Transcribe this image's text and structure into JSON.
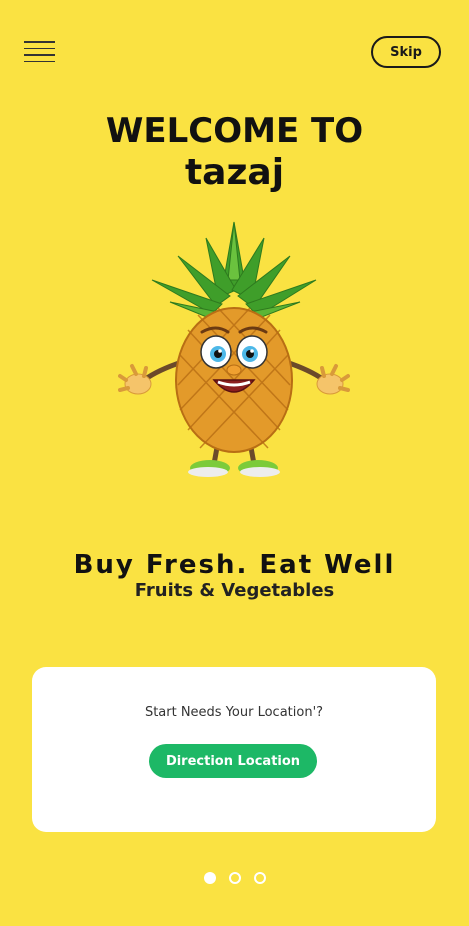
{
  "header": {
    "menu_icon": "hamburger-menu-icon",
    "skip_label": "Skip"
  },
  "hero": {
    "title_line1": "WELCOME TO",
    "title_line2": "tazaj",
    "image": "pineapple-mascot"
  },
  "tagline": {
    "main": "Buy Fresh. Eat Well",
    "sub": "Fruits & Vegetables"
  },
  "location_card": {
    "question": "Start Needs Your  Location'?",
    "button_label": "Direction  Location"
  },
  "pager": {
    "count": 3,
    "active_index": 0
  },
  "colors": {
    "background": "#FAE242",
    "accent_green": "#1DB866",
    "card": "#FFFFFF",
    "text": "#111111"
  }
}
